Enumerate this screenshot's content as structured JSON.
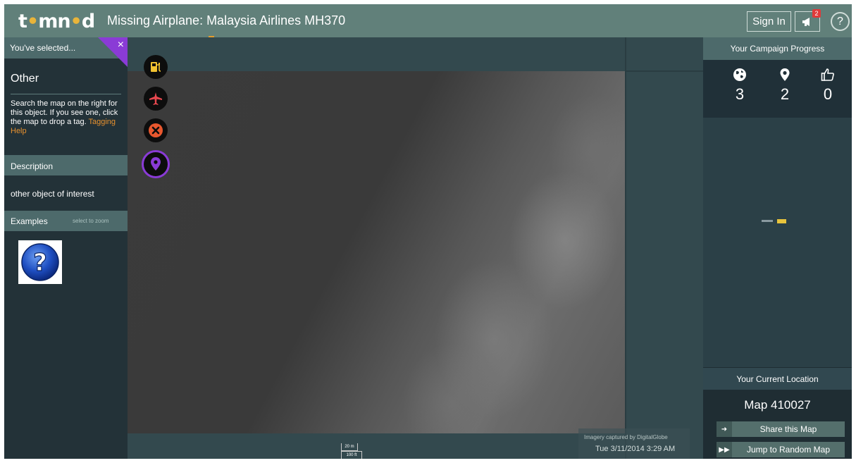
{
  "header": {
    "logo_text_1": "t",
    "logo_text_2": "mn",
    "logo_text_3": "d",
    "title": "Missing Airplane: Malaysia Airlines MH370",
    "sign_in_label": "Sign In",
    "notification_count": "2",
    "help_label": "?"
  },
  "left_panel": {
    "selected_label": "You've selected...",
    "close_label": "×",
    "object_name": "Other",
    "instructions": "Search the map on the right for this object. If you see one, click the map to drop a tag. ",
    "tagging_help_link": "Tagging Help",
    "description_header": "Description",
    "description_text": "other object of interest",
    "examples_header": "Examples",
    "examples_hint": "select to zoom"
  },
  "tools": [
    {
      "name": "fuel-tool",
      "icon": "fuel-pump-icon",
      "color": "#f2c230"
    },
    {
      "name": "plane-tool",
      "icon": "airplane-icon",
      "color": "#e8484f"
    },
    {
      "name": "wreck-tool",
      "icon": "x-circle-icon",
      "color": "#e8572e"
    },
    {
      "name": "other-tool",
      "icon": "map-pin-icon",
      "color": "#8a3bd6"
    }
  ],
  "map": {
    "scale_metric": "20 m",
    "scale_imperial": "100 ft",
    "imagery_credit": "Imagery captured by DigitalGlobe",
    "imagery_date": "Tue 3/11/2014 3:29 AM"
  },
  "right_panel": {
    "progress_header": "Your Campaign Progress",
    "stats": {
      "maps_searched": "3",
      "tags_placed": "2",
      "agreements": "0"
    },
    "location_header": "Your Current Location",
    "map_id": "Map 410027",
    "share_label": "Share this Map",
    "random_label": "Jump to Random Map"
  },
  "colors": {
    "header_bg": "#61807a",
    "accent_purple": "#8a3bd6",
    "link_orange": "#e7912e",
    "panel_header": "#4d6a6b"
  }
}
